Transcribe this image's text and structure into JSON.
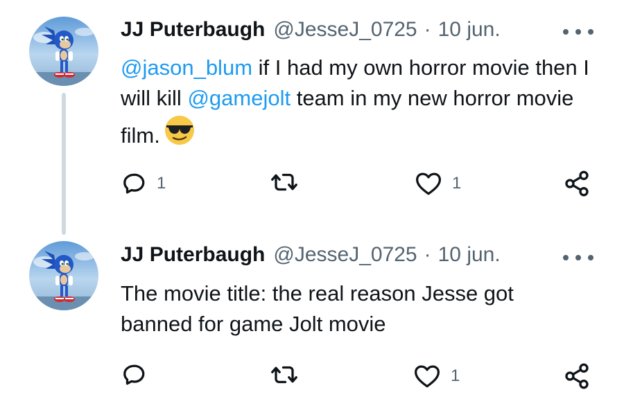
{
  "tweets": [
    {
      "author_name": "JJ Puterbaugh",
      "handle": "@JesseJ_0725",
      "separator": "·",
      "date": "10 jun.",
      "text_parts": {
        "mention1": "@jason_blum",
        "t1": " if I had my own horror movie then I will kill ",
        "mention2": "@gamejolt",
        "t2": " team in my new horror movie film."
      },
      "emoji": "sunglasses-face",
      "reply_count": "1",
      "like_count": "1"
    },
    {
      "author_name": "JJ Puterbaugh",
      "handle": "@JesseJ_0725",
      "separator": "·",
      "date": "10 jun.",
      "text": "The movie title: the real reason Jesse got banned for game Jolt movie",
      "like_count": "1"
    }
  ],
  "icons": {
    "reply": "reply-icon",
    "retweet": "retweet-icon",
    "like": "heart-icon",
    "share": "share-icon",
    "more": "more-icon"
  },
  "colors": {
    "text": "#0f1419",
    "secondary": "#536471",
    "mention": "#1d9bf0",
    "thread_line": "#cfd9de"
  }
}
